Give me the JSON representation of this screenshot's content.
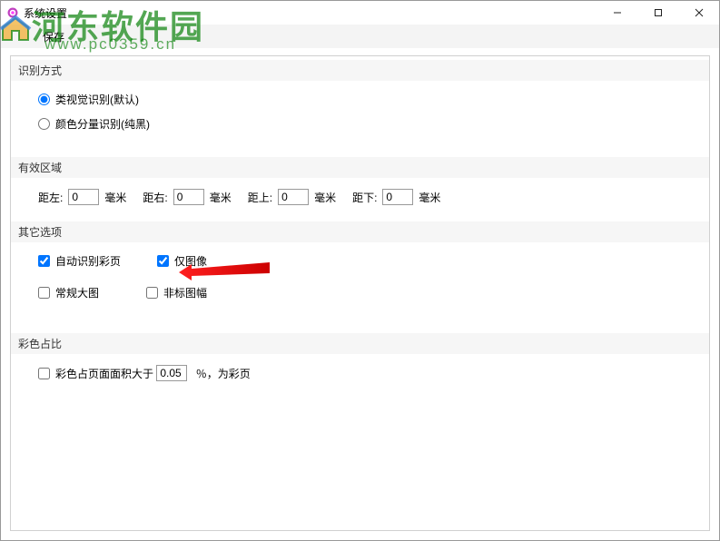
{
  "window": {
    "title": "系统设置",
    "minimize": "—",
    "maximize": "▢",
    "close": "✕"
  },
  "toolbar": {
    "save_label": "保存"
  },
  "watermark": {
    "logo_text": "河东软件园",
    "url": "www.pc0359.cn"
  },
  "sections": {
    "recognition": {
      "header": "识别方式",
      "option_visual": "类视觉识别(默认)",
      "option_color": "颜色分量识别(纯黑)"
    },
    "region": {
      "header": "有效区域",
      "left_label": "距左:",
      "right_label": "距右:",
      "top_label": "距上:",
      "bottom_label": "距下:",
      "unit": "毫米",
      "left_val": "0",
      "right_val": "0",
      "top_val": "0",
      "bottom_val": "0"
    },
    "other": {
      "header": "其它选项",
      "auto_color": "自动识别彩页",
      "image_only": "仅图像",
      "regular_big": "常规大图",
      "nonstd_frame": "非标图幅"
    },
    "ratio": {
      "header": "彩色占比",
      "prefix": "彩色占页面面积大于",
      "value": "0.05",
      "suffix": "％，为彩页"
    }
  }
}
